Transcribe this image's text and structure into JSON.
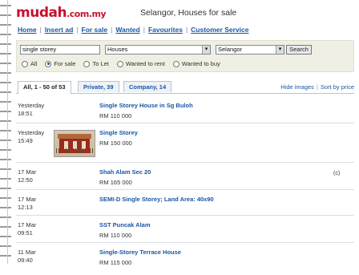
{
  "header": {
    "logo": "mudah",
    "logo_domain": ".com.my",
    "title": "Selangor, Houses for sale"
  },
  "nav": [
    "Home",
    "Insert ad",
    "For sale",
    "Wanted",
    "Favourites",
    "Customer Service"
  ],
  "search": {
    "query": "single storey",
    "category": "Houses",
    "region": "Selangor",
    "button": "Search",
    "radios": [
      {
        "label": "All",
        "checked": false
      },
      {
        "label": "For sale",
        "checked": true
      },
      {
        "label": "To Let",
        "checked": false
      },
      {
        "label": "Wanted to rent",
        "checked": false
      },
      {
        "label": "Wanted to buy",
        "checked": false
      }
    ]
  },
  "tabs": {
    "all": "All, 1 - 50 of 53",
    "private": "Private, 39",
    "company": "Company, 14",
    "hide_images": "Hide images",
    "sort": "Sort by price"
  },
  "listings": [
    {
      "date": "Yesterday",
      "time": "18:51",
      "title": "Single Storey House in Sg Buloh",
      "price": "RM 110 000",
      "company": ""
    },
    {
      "date": "Yesterday",
      "time": "15:49",
      "title": "Single Storey",
      "price": "RM 150 000",
      "company": ""
    },
    {
      "date": "17 Mar",
      "time": "12:50",
      "title": "Shah Alam Sec 20",
      "price": "RM 165 000",
      "company": "(c)"
    },
    {
      "date": "17 Mar",
      "time": "12:13",
      "title": "SEMI-D Single Storey; Land Area: 40x90",
      "price": "",
      "company": ""
    },
    {
      "date": "17 Mar",
      "time": "09:51",
      "title": "SST Puncak Alam",
      "price": "RM 110 000",
      "company": ""
    },
    {
      "date": "11 Mar",
      "time": "09:40",
      "title": "Single-Storey Terrace House",
      "price": "RM 115 000",
      "company": ""
    }
  ],
  "colors": {
    "logo": "#c8102e",
    "link": "#1a56a6",
    "search_bg": "#efefe3"
  }
}
